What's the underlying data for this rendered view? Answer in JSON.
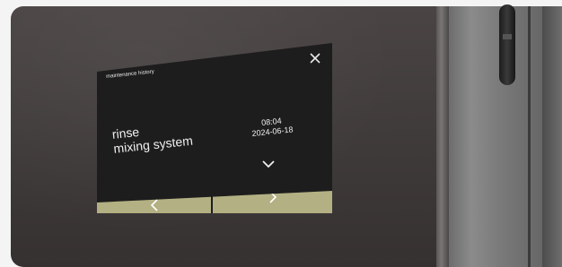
{
  "screen": {
    "title": "maintenance history",
    "close_icon": "close-icon",
    "entry": {
      "name": "rinse\nmixing system",
      "time": "08:04",
      "date": "2024-06-18"
    },
    "expand_icon": "chevron-down-icon",
    "nav": {
      "prev_icon": "chevron-left-icon",
      "next_icon": "chevron-right-icon"
    }
  },
  "colors": {
    "screen_background": "#1d1d1d",
    "nav_button": "#b3b083",
    "text": "#f0f0f0"
  }
}
